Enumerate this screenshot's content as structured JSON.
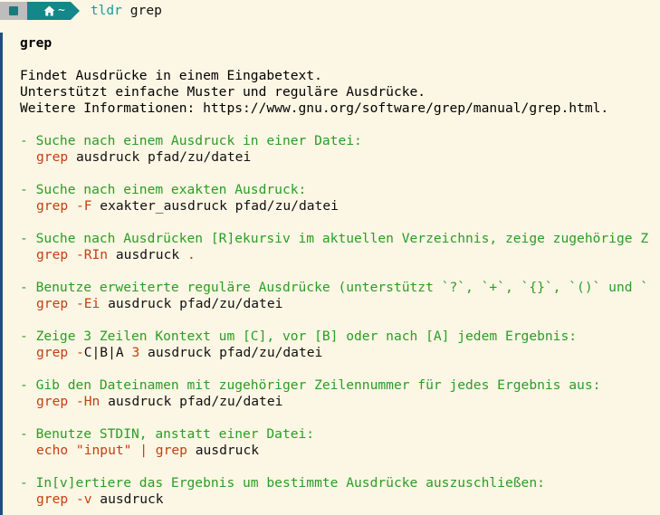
{
  "prompt": {
    "os_icon": "os-logo-icon",
    "home_icon": "home-icon",
    "path": "~",
    "command": "tldr",
    "argument": "grep"
  },
  "page": {
    "title": "grep",
    "description": [
      "Findet Ausdrücke in einem Eingabetext.",
      "Unterstützt einfache Muster und reguläre Ausdrücke.",
      "Weitere Informationen: https://www.gnu.org/software/grep/manual/grep.html."
    ],
    "examples": [
      {
        "description": "- Suche nach einem Ausdruck in einer Datei:",
        "command": "grep",
        "flags": "",
        "args": " ausdruck pfad/zu/datei"
      },
      {
        "description": "- Suche nach einem exakten Ausdruck:",
        "command": "grep",
        "flags": " -F",
        "args": " exakter_ausdruck pfad/zu/datei"
      },
      {
        "description": "- Suche nach Ausdrücken [R]ekursiv im aktuellen Verzeichnis, zeige zugehörige Z",
        "command": "grep",
        "flags": " -RIn",
        "args": " ausdruck",
        "trailing": " ."
      },
      {
        "description": "- Benutze erweiterte reguläre Ausdrücke (unterstützt `?`, `+`, `{}`, `()` und `",
        "command": "grep",
        "flags": " -Ei",
        "args": " ausdruck pfad/zu/datei"
      },
      {
        "description": "- Zeige 3 Zeilen Kontext um [C], vor [B] oder nach [A] jedem Ergebnis:",
        "command": "grep",
        "flags": " -",
        "flag_value": "C|B|A",
        "number": " 3",
        "args": " ausdruck pfad/zu/datei"
      },
      {
        "description": "- Gib den Dateinamen mit zugehöriger Zeilennummer für jedes Ergebnis aus:",
        "command": "grep",
        "flags": " -Hn",
        "args": " ausdruck pfad/zu/datei"
      },
      {
        "description": "- Benutze STDIN, anstatt einer Datei:",
        "command_prefix": "echo \"input\" | ",
        "command": "grep",
        "flags": "",
        "args": " ausdruck"
      },
      {
        "description": "- In[v]ertiere das Ergebnis um bestimmte Ausdrücke auszuschließen:",
        "command": "grep",
        "flags": " -v",
        "args": " ausdruck"
      }
    ]
  },
  "colors": {
    "background": "#fcf6e4",
    "description_green": "#2a9d26",
    "command_red": "#c24011",
    "prompt_teal": "#13878a",
    "left_bar": "#1f4e86"
  }
}
